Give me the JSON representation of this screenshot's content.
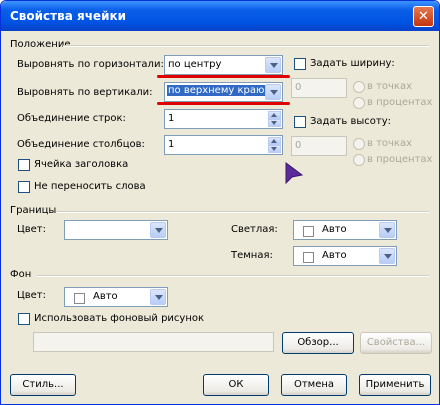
{
  "title": "Свойства ячейки",
  "close_label": "✕",
  "position": {
    "group": "Положение",
    "h_align_label": "Выровнять по горизонтали:",
    "h_align_value": "по центру",
    "v_align_label": "Выровнять по вертикали:",
    "v_align_value": "по верхнему краю",
    "row_span_label": "Объединение строк:",
    "row_span_value": "1",
    "col_span_label": "Объединение столбцов:",
    "col_span_value": "1",
    "header_cell_label": "Ячейка заголовка",
    "no_wrap_label": "Не переносить слова",
    "set_width_label": "Задать ширину:",
    "width_value": "0",
    "in_points": "в точках",
    "in_percent": "в процентах",
    "set_height_label": "Задать высоту:",
    "height_value": "0"
  },
  "borders": {
    "group": "Границы",
    "color_label": "Цвет:",
    "color_value": "",
    "light_label": "Светлая:",
    "light_value": "Авто",
    "dark_label": "Темная:",
    "dark_value": "Авто"
  },
  "background": {
    "group": "Фон",
    "color_label": "Цвет:",
    "color_value": "Авто",
    "use_image_label": "Использовать фоновый рисунок",
    "browse_label": "Обзор...",
    "properties_label": "Свойства..."
  },
  "footer": {
    "style_label": "Стиль...",
    "ok_label": "ОК",
    "cancel_label": "Отмена",
    "apply_label": "Применить"
  },
  "colors": {
    "annotation_red": "#e00000",
    "cursor": "#5a2a9a"
  }
}
